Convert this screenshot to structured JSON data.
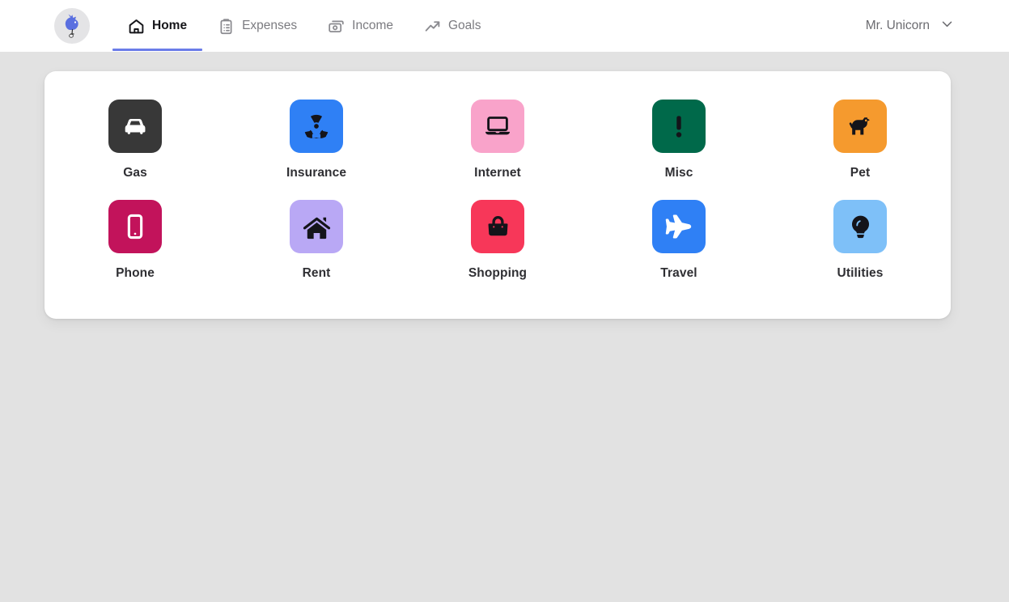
{
  "header": {
    "logo": {
      "icon": "unicorn-logo-icon",
      "alt": "Unicorn logo"
    },
    "nav": [
      {
        "label": "Home",
        "icon": "home-icon",
        "active": true
      },
      {
        "label": "Expenses",
        "icon": "clipboard-list-icon",
        "active": false
      },
      {
        "label": "Income",
        "icon": "banknote-icon",
        "active": false
      },
      {
        "label": "Goals",
        "icon": "trending-up-icon",
        "active": false
      }
    ],
    "active_indicator_color": "#6b7ce8",
    "user": {
      "name": "Mr. Unicorn",
      "chevron_icon": "chevron-down-icon"
    }
  },
  "main": {
    "categories": [
      {
        "label": "Gas",
        "icon": "car-icon",
        "tile_color": "#383838",
        "icon_color": "#ffffff"
      },
      {
        "label": "Insurance",
        "icon": "radiation-icon",
        "tile_color": "#2f80f5",
        "icon_color": "#14141a"
      },
      {
        "label": "Internet",
        "icon": "laptop-icon",
        "tile_color": "#f9a3ca",
        "icon_color": "#14141a"
      },
      {
        "label": "Misc",
        "icon": "exclamation-icon",
        "tile_color": "#00694a",
        "icon_color": "#14141a"
      },
      {
        "label": "Pet",
        "icon": "dog-icon",
        "tile_color": "#f59a2e",
        "icon_color": "#14141a"
      },
      {
        "label": "Phone",
        "icon": "smartphone-icon",
        "tile_color": "#c2135b",
        "icon_color": "#ffffff"
      },
      {
        "label": "Rent",
        "icon": "house-icon",
        "tile_color": "#b9a8f5",
        "icon_color": "#14141a"
      },
      {
        "label": "Shopping",
        "icon": "shopping-bag-icon",
        "tile_color": "#f73759",
        "icon_color": "#14141a"
      },
      {
        "label": "Travel",
        "icon": "airplane-icon",
        "tile_color": "#2f80f5",
        "icon_color": "#ffffff"
      },
      {
        "label": "Utilities",
        "icon": "lightbulb-icon",
        "tile_color": "#7ec0f8",
        "icon_color": "#14141a"
      }
    ]
  },
  "theme": {
    "page_background": "#e2e2e2",
    "card_background": "#ffffff",
    "accent": "#6b7ce8"
  }
}
